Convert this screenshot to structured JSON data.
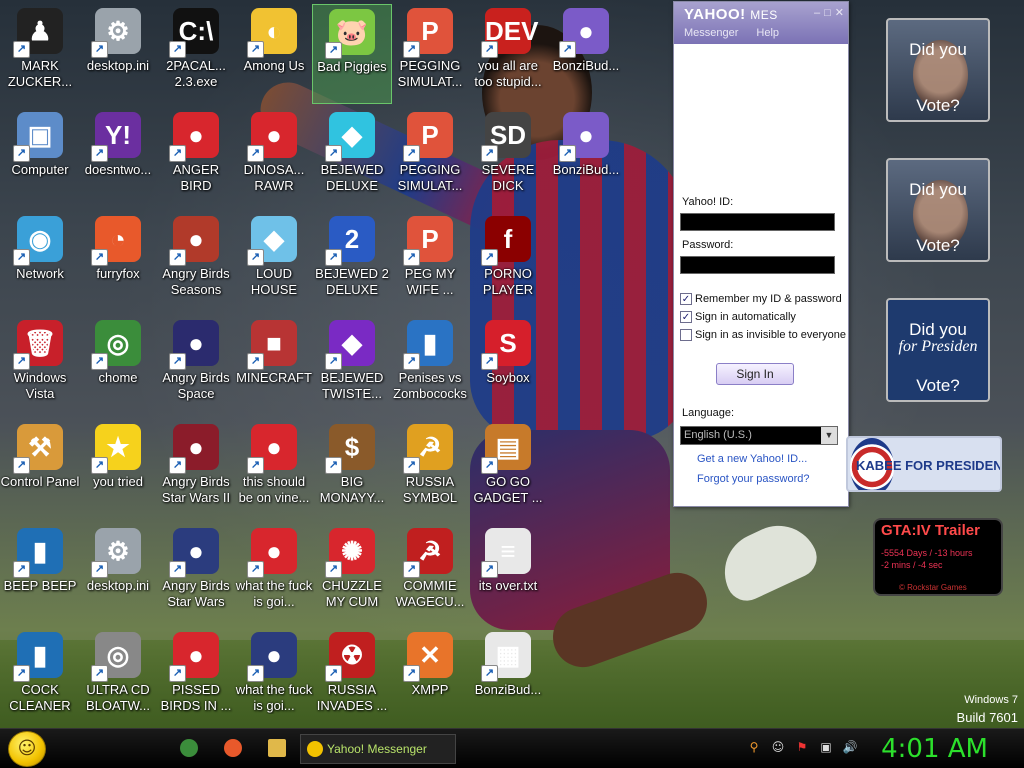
{
  "desktop": {
    "icons": [
      {
        "label": "MARK ZUCKER...",
        "color": "#222",
        "glyph": "♟",
        "selected": false
      },
      {
        "label": "desktop.ini",
        "color": "#9aa3ab",
        "glyph": "⚙",
        "selected": false
      },
      {
        "label": "2PACAL... 2.3.exe",
        "color": "#111",
        "glyph": "C:\\",
        "selected": false
      },
      {
        "label": "Among Us",
        "color": "#f1c232",
        "glyph": "◐",
        "selected": false
      },
      {
        "label": "Bad Piggies",
        "color": "#7cc742",
        "glyph": "🐷",
        "selected": true
      },
      {
        "label": "PEGGING SIMULAT...",
        "color": "#e0533b",
        "glyph": "P",
        "selected": false
      },
      {
        "label": "you all are too stupid...",
        "color": "#c9211e",
        "glyph": "DEV",
        "selected": false
      },
      {
        "label": "BonziBud...",
        "color": "#7b5bc8",
        "glyph": "●",
        "selected": false
      },
      {
        "label": "Computer",
        "color": "#5d8cc9",
        "glyph": "▣",
        "selected": false
      },
      {
        "label": "doesntwo...",
        "color": "#6b2fa0",
        "glyph": "Y!",
        "selected": false
      },
      {
        "label": "ANGER BIRD",
        "color": "#d8262d",
        "glyph": "●",
        "selected": false
      },
      {
        "label": "DINOSA... RAWR",
        "color": "#d8262d",
        "glyph": "●",
        "selected": false
      },
      {
        "label": "BEJEWED DELUXE",
        "color": "#30c3e0",
        "glyph": "◆",
        "selected": false
      },
      {
        "label": "PEGGING SIMULAT...",
        "color": "#e0533b",
        "glyph": "P",
        "selected": false
      },
      {
        "label": "SEVERE DICK",
        "color": "#444",
        "glyph": "SD",
        "selected": false
      },
      {
        "label": "BonziBud...",
        "color": "#7b5bc8",
        "glyph": "●",
        "selected": false
      },
      {
        "label": "Network",
        "color": "#3aa0d8",
        "glyph": "◉",
        "selected": false
      },
      {
        "label": "furryfox",
        "color": "#e8592b",
        "glyph": "◔",
        "selected": false
      },
      {
        "label": "Angry Birds Seasons",
        "color": "#b13a2a",
        "glyph": "●",
        "selected": false
      },
      {
        "label": "LOUD HOUSE",
        "color": "#6fc1e8",
        "glyph": "◆",
        "selected": false
      },
      {
        "label": "BEJEWED 2 DELUXE",
        "color": "#2a5bc4",
        "glyph": "2",
        "selected": false
      },
      {
        "label": "PEG MY WIFE ...",
        "color": "#e0533b",
        "glyph": "P",
        "selected": false
      },
      {
        "label": "PORNO PLAYER",
        "color": "#8b0000",
        "glyph": "f",
        "selected": false
      },
      {
        "label": "Windows Vista",
        "color": "#c8202a",
        "glyph": "🗑",
        "selected": false
      },
      {
        "label": "chome",
        "color": "#3b8d3b",
        "glyph": "◎",
        "selected": false
      },
      {
        "label": "Angry Birds Space",
        "color": "#2b2b6e",
        "glyph": "●",
        "selected": false
      },
      {
        "label": "MINECRAFT",
        "color": "#b83434",
        "glyph": "■",
        "selected": false
      },
      {
        "label": "BEJEWED TWISTE...",
        "color": "#7a2ac4",
        "glyph": "◆",
        "selected": false
      },
      {
        "label": "Penises vs Zombococks",
        "color": "#2a73c4",
        "glyph": "▮",
        "selected": false
      },
      {
        "label": "Soybox",
        "color": "#d61f2b",
        "glyph": "S",
        "selected": false
      },
      {
        "label": "Control Panel",
        "color": "#d99a3a",
        "glyph": "⚒",
        "selected": false
      },
      {
        "label": "you tried",
        "color": "#f6d21c",
        "glyph": "★",
        "selected": false
      },
      {
        "label": "Angry Birds Star Wars II",
        "color": "#8b1c2a",
        "glyph": "●",
        "selected": false
      },
      {
        "label": "this should be on vine...",
        "color": "#d8262d",
        "glyph": "●",
        "selected": false
      },
      {
        "label": "BIG MONAYY...",
        "color": "#8a5a2a",
        "glyph": "$",
        "selected": false
      },
      {
        "label": "RUSSIA SYMBOL",
        "color": "#e0a020",
        "glyph": "☭",
        "selected": false
      },
      {
        "label": "GO GO GADGET ...",
        "color": "#c77a2a",
        "glyph": "▤",
        "selected": false
      },
      {
        "label": "BEEP BEEP",
        "color": "#1f6fb5",
        "glyph": "▮",
        "selected": false
      },
      {
        "label": "desktop.ini",
        "color": "#9aa3ab",
        "glyph": "⚙",
        "selected": false
      },
      {
        "label": "Angry Birds Star Wars",
        "color": "#2b3c7e",
        "glyph": "●",
        "selected": false
      },
      {
        "label": "what the fuck is goi...",
        "color": "#d8262d",
        "glyph": "●",
        "selected": false
      },
      {
        "label": "CHUZZLE MY CUM",
        "color": "#d8262d",
        "glyph": "✺",
        "selected": false
      },
      {
        "label": "COMMIE WAGECU...",
        "color": "#c01f1f",
        "glyph": "☭",
        "selected": false
      },
      {
        "label": "its over.txt",
        "color": "#e8e8e8",
        "glyph": "≡",
        "selected": false
      },
      {
        "label": "COCK CLEANER",
        "color": "#1f6fb5",
        "glyph": "▮",
        "selected": false
      },
      {
        "label": "ULTRA CD BLOATW...",
        "color": "#888",
        "glyph": "◎",
        "selected": false
      },
      {
        "label": "PISSED BIRDS IN ...",
        "color": "#d8262d",
        "glyph": "●",
        "selected": false
      },
      {
        "label": "what the fuck is goi...",
        "color": "#2b3c7e",
        "glyph": "●",
        "selected": false
      },
      {
        "label": "RUSSIA INVADES ...",
        "color": "#c01f1f",
        "glyph": "☢",
        "selected": false
      },
      {
        "label": "XMPP",
        "color": "#e8742a",
        "glyph": "✕",
        "selected": false
      },
      {
        "label": "BonziBud...",
        "color": "#e8e8e8",
        "glyph": "▦",
        "selected": false
      }
    ]
  },
  "messenger": {
    "title": "YAHOO!",
    "title_suffix": "MES",
    "menu_messenger": "Messenger",
    "menu_help": "Help",
    "yahoo_id_label": "Yahoo! ID:",
    "yahoo_id_value": "",
    "password_label": "Password:",
    "password_value": "",
    "remember_label": "Remember my ID & password",
    "remember_checked": true,
    "auto_label": "Sign in automatically",
    "auto_checked": true,
    "invisible_label": "Sign in as invisible to everyone",
    "invisible_checked": false,
    "signin_button": "Sign In",
    "language_label": "Language:",
    "language_value": "English (U.S.)",
    "new_id_link": "Get a new Yahoo! ID...",
    "forgot_link": "Forgot your password?"
  },
  "gadgets": {
    "vote1_line1": "Did you",
    "vote1_line2": "Vote?",
    "vote2_line1": "Did you",
    "vote2_line2": "Vote?",
    "vote3_line1": "Did you",
    "vote3_line1b": "for Presiden",
    "vote3_line2": "Vote?",
    "huck_text": "KABEE FOR PRESIDENT",
    "gta_title": "GTA:IV Trailer",
    "gta_row1": "-5554 Days / -13 hours",
    "gta_row2": "-2 mins / -4 sec",
    "gta_brand": "© Rockstar Games"
  },
  "watermark": {
    "line1": "Windows 7",
    "line2": "Build 7601"
  },
  "taskbar": {
    "yahoo_task": "Yahoo! Messenger",
    "clock": "4:01 AM"
  }
}
